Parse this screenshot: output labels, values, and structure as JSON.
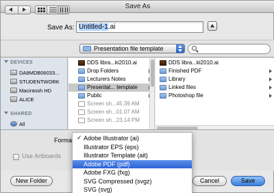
{
  "window": {
    "title": "Save As"
  },
  "save_as": {
    "label": "Save As:",
    "filename_selected": "Untitled-1",
    "filename_ext": ".ai"
  },
  "toolbar": {
    "location": "Presentation file template",
    "search_placeholder": ""
  },
  "sidebar": {
    "devices_header": "DEVICES",
    "devices": [
      {
        "label": "DA8MDB06033...",
        "icon": "hard-drive-icon"
      },
      {
        "label": "STUDENTWORK",
        "icon": "hard-drive-icon"
      },
      {
        "label": "Macintosh HD",
        "icon": "hard-drive-icon"
      },
      {
        "label": "ALICE",
        "icon": "hard-drive-icon"
      }
    ],
    "shared_header": "SHARED",
    "shared": [
      {
        "label": "All",
        "icon": "network-globe-icon"
      }
    ]
  },
  "column1": {
    "items": [
      {
        "label": "DDS libra...ki2010.ai",
        "icon": "ai-file-icon"
      },
      {
        "label": "Drop Folders",
        "icon": "folder-icon"
      },
      {
        "label": "Lecturers Notes",
        "icon": "folder-icon"
      },
      {
        "label": "Presentat... template",
        "icon": "folder-icon"
      },
      {
        "label": "Public",
        "icon": "folder-icon"
      },
      {
        "label": "Screen sh...45.39 AM",
        "icon": "document-icon"
      },
      {
        "label": "Screen sh...01.07 AM",
        "icon": "document-icon"
      },
      {
        "label": "Screen sh...23.14 PM",
        "icon": "document-icon"
      }
    ]
  },
  "column2": {
    "items": [
      {
        "label": "DDS libra...ki2010.ai",
        "icon": "ai-file-icon"
      },
      {
        "label": "Finished PDF",
        "icon": "folder-icon"
      },
      {
        "label": "Library",
        "icon": "folder-icon"
      },
      {
        "label": "Linked files",
        "icon": "folder-icon"
      },
      {
        "label": "Photoshop file",
        "icon": "folder-icon"
      }
    ]
  },
  "options": {
    "format_label": "Format",
    "use_artboards_label": "Use Artboards"
  },
  "format_menu": {
    "checked": "Adobe Illustrator (ai)",
    "highlighted": "Adobe PDF (pdf)",
    "items": [
      "Adobe Illustrator (ai)",
      "Illustrator EPS (eps)",
      "Illustrator Template (ait)",
      "Adobe PDF (pdf)",
      "Adobe FXG (fxg)",
      "SVG Compressed (svgz)",
      "SVG (svg)"
    ]
  },
  "buttons": {
    "new_folder": "New Folder",
    "cancel": "Cancel",
    "save": "Save"
  },
  "colors": {
    "accent": "#3a80dc",
    "highlight": "#2c63d8",
    "sidebar_bg": "#dde4ec"
  }
}
